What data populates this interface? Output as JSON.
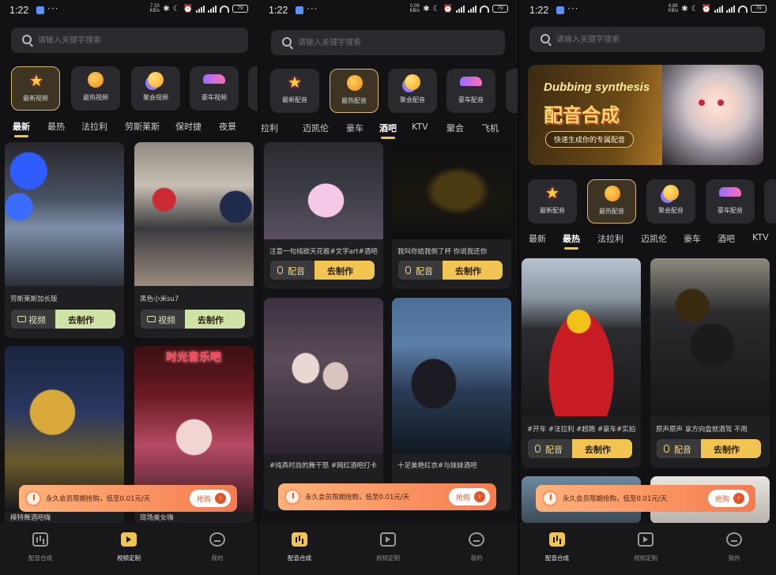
{
  "status": {
    "panels": [
      {
        "time": "1:22",
        "speed": "7.33\nKB/s",
        "battery": "79"
      },
      {
        "time": "1:22",
        "speed": "0.08\nKB/s",
        "battery": "79"
      },
      {
        "time": "1:22",
        "speed": "6.88\nKB/s",
        "battery": "79"
      }
    ]
  },
  "search": {
    "placeholder": "请输入关键字搜索"
  },
  "panel0": {
    "categories": [
      "最新视频",
      "最热视频",
      "聚会视频",
      "豪车视频"
    ],
    "tabs": [
      "最新",
      "最热",
      "法拉利",
      "劳斯莱斯",
      "保时捷",
      "夜景"
    ],
    "cards": [
      {
        "title": "劳斯莱斯加长版",
        "tag": "视频",
        "action": "去制作"
      },
      {
        "title": "黑色小米su7",
        "tag": "视频",
        "action": "去制作"
      },
      {
        "title": "模特舞酒吧嗨",
        "tag": "",
        "action": ""
      },
      {
        "title": "现场美女嗨",
        "tag": "",
        "action": ""
      }
    ],
    "promo_sign": "时光音乐吧",
    "nav": [
      "配音合成",
      "视频定制",
      "我的"
    ]
  },
  "panel1": {
    "categories": [
      "最新配音",
      "最热配音",
      "聚会配音",
      "豪车配音"
    ],
    "tabs": [
      "拉利",
      "迈凯伦",
      "豪车",
      "酒吧",
      "KTV",
      "聚会",
      "飞机"
    ],
    "cards": [
      {
        "title": "注意一句纯欲天花板#文字art#酒吧",
        "tag": "配音",
        "action": "去制作"
      },
      {
        "title": "我叫你给我倒了杯 你说我还你",
        "tag": "配音",
        "action": "去制作"
      },
      {
        "title": "#纯真时尚的舞干怒 #网红酒吧打卡",
        "tag": "",
        "action": ""
      },
      {
        "title": "十足美艳红衣#与妹妹酒吧",
        "tag": "",
        "action": ""
      }
    ],
    "nav": [
      "配音合成",
      "视频定制",
      "我的"
    ]
  },
  "panel2": {
    "hero": {
      "en": "Dubbing synthesis",
      "cn": "配音合成",
      "sub": "快速生成你的专属配音"
    },
    "categories": [
      "最新配音",
      "最热配音",
      "聚会配音",
      "豪车配音"
    ],
    "tabs": [
      "最新",
      "最热",
      "法拉利",
      "迈凯伦",
      "豪车",
      "酒吧",
      "KTV"
    ],
    "cards": [
      {
        "title": "#开车 #法拉利 #超跑 #豪车#实拍",
        "tag": "配音",
        "action": "去制作"
      },
      {
        "title": "原声原声 拿方向盘就酒驾 不用",
        "tag": "配音",
        "action": "去制作"
      }
    ],
    "nav": [
      "配音合成",
      "视频定制",
      "我的"
    ]
  },
  "banner": {
    "text": "永久会员限期抢购，低至0.01元/天",
    "button": "抢购"
  },
  "colors": {
    "accent": "#f2c451",
    "pill_green": "#cfe3a7",
    "banner": "#f47c50"
  }
}
